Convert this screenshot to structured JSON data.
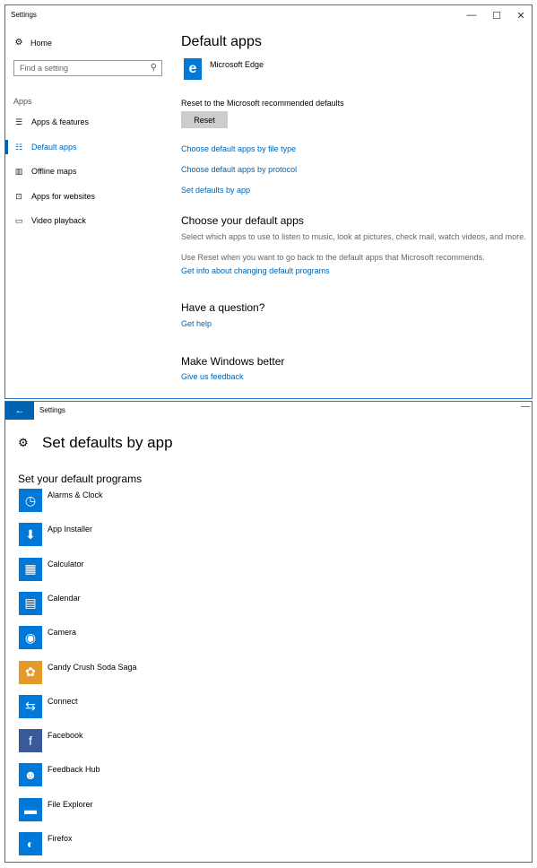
{
  "window1": {
    "title": "Settings",
    "controls": {
      "minimize": "—",
      "maximize": "☐",
      "close": "✕"
    },
    "sidebar": {
      "home": "Home",
      "search_placeholder": "Find a setting",
      "section": "Apps",
      "items": [
        {
          "label": "Apps & features",
          "icon": "☰"
        },
        {
          "label": "Default apps",
          "icon": "☷"
        },
        {
          "label": "Offline maps",
          "icon": "▥"
        },
        {
          "label": "Apps for websites",
          "icon": "⊡"
        },
        {
          "label": "Video playback",
          "icon": "▭"
        }
      ]
    },
    "main": {
      "title": "Default apps",
      "browser_name": "Microsoft Edge",
      "browser_icon": "e",
      "reset_text": "Reset to the Microsoft recommended defaults",
      "reset_button": "Reset",
      "links": [
        "Choose default apps by file type",
        "Choose default apps by protocol",
        "Set defaults by app"
      ],
      "choose_heading": "Choose your default apps",
      "choose_desc": "Select which apps to use to listen to music, look at pictures, check mail, watch videos, and more.",
      "reset_info": "Use Reset when you want to go back to the default apps that Microsoft recommends.",
      "info_link": "Get info about changing default programs",
      "question_heading": "Have a question?",
      "help_link": "Get help",
      "better_heading": "Make Windows better",
      "feedback_link": "Give us feedback"
    }
  },
  "window2": {
    "title": "Settings",
    "back": "←",
    "minimize": "—",
    "heading_icon": "⚙",
    "heading": "Set defaults by app",
    "subheading": "Set your default programs",
    "apps": [
      {
        "name": "Alarms & Clock",
        "icon": "◷",
        "color": "#0078d7"
      },
      {
        "name": "App Installer",
        "icon": "⬇",
        "color": "#0078d7"
      },
      {
        "name": "Calculator",
        "icon": "▦",
        "color": "#0078d7"
      },
      {
        "name": "Calendar",
        "icon": "▤",
        "color": "#0078d7"
      },
      {
        "name": "Camera",
        "icon": "◉",
        "color": "#0078d7"
      },
      {
        "name": "Candy Crush Soda Saga",
        "icon": "✿",
        "color": "#e39a2a"
      },
      {
        "name": "Connect",
        "icon": "⇆",
        "color": "#0078d7"
      },
      {
        "name": "Facebook",
        "icon": "f",
        "color": "#3b5998"
      },
      {
        "name": "Feedback Hub",
        "icon": "☻",
        "color": "#0078d7"
      },
      {
        "name": "File Explorer",
        "icon": "▬",
        "color": "#0078d7"
      },
      {
        "name": "Firefox",
        "icon": "◐",
        "color": "#0078d7"
      }
    ]
  }
}
